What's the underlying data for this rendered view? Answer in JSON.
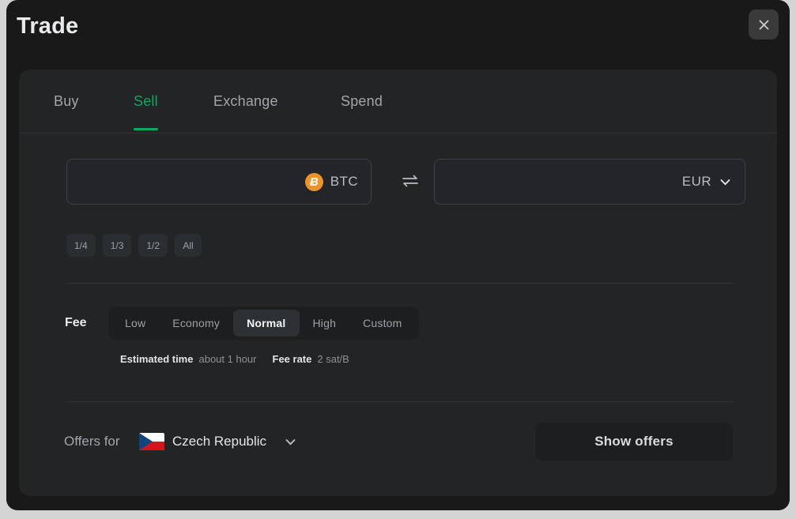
{
  "modal": {
    "title": "Trade",
    "close_icon": "close-icon"
  },
  "tabs": [
    {
      "label": "Buy",
      "active": false
    },
    {
      "label": "Sell",
      "active": true
    },
    {
      "label": "Exchange",
      "active": false
    },
    {
      "label": "Spend",
      "active": false
    }
  ],
  "amount": {
    "from": {
      "value": "",
      "placeholder": "",
      "currency": "BTC",
      "icon": "bitcoin-icon",
      "icon_symbol": "Ƀ"
    },
    "swap_icon": "swap-arrows-icon",
    "to": {
      "value": "",
      "placeholder": "",
      "currency": "EUR",
      "dropdown_icon": "chevron-down-icon"
    }
  },
  "fractions": [
    {
      "label": "1/4"
    },
    {
      "label": "1/3"
    },
    {
      "label": "1/2"
    },
    {
      "label": "All"
    }
  ],
  "fee": {
    "label": "Fee",
    "options": [
      {
        "label": "Low",
        "selected": false
      },
      {
        "label": "Economy",
        "selected": false
      },
      {
        "label": "Normal",
        "selected": true
      },
      {
        "label": "High",
        "selected": false
      },
      {
        "label": "Custom",
        "selected": false
      }
    ],
    "estimated_time_key": "Estimated time",
    "estimated_time_value": "about 1 hour",
    "fee_rate_key": "Fee rate",
    "fee_rate_value": "2 sat/B"
  },
  "offers": {
    "label": "Offers for",
    "country": "Czech Republic",
    "country_flag_icon": "czech-republic-flag-icon",
    "dropdown_icon": "chevron-down-icon",
    "button_label": "Show offers"
  },
  "colors": {
    "page_background": "#d4d4d4",
    "modal_background": "#191919",
    "card_background": "#222426",
    "accent_green": "#11a75c",
    "bitcoin_orange": "#f0922b",
    "flag_blue": "#11457e",
    "flag_red": "#d7141a"
  }
}
